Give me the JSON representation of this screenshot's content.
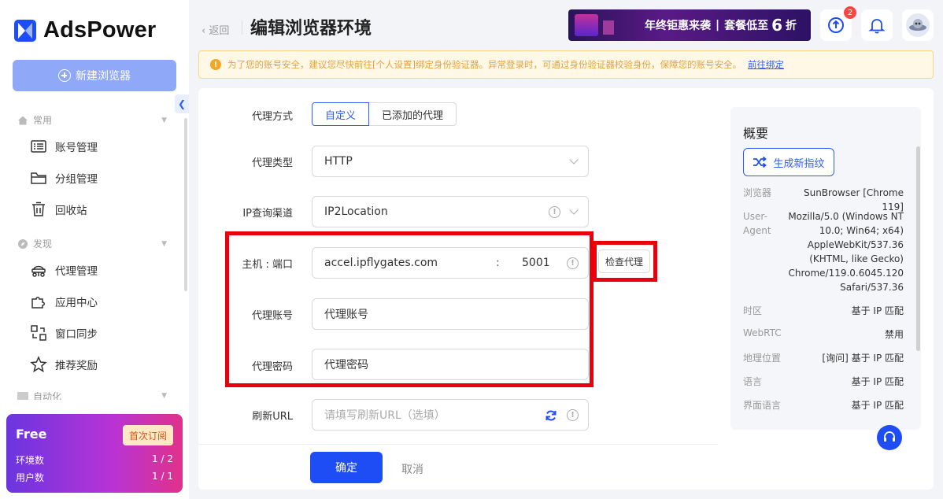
{
  "app": {
    "name": "AdsPower",
    "new_browser": "新建浏览器"
  },
  "sidebar": {
    "section_common": "常用",
    "section_discover": "发现",
    "section_auto": "自动化",
    "items": [
      {
        "label": "账号管理",
        "icon": "account-list-icon"
      },
      {
        "label": "分组管理",
        "icon": "folder-icon"
      },
      {
        "label": "回收站",
        "icon": "trash-icon"
      },
      {
        "label": "代理管理",
        "icon": "proxy-icon"
      },
      {
        "label": "应用中心",
        "icon": "puzzle-icon"
      },
      {
        "label": "窗口同步",
        "icon": "sync-icon"
      },
      {
        "label": "推荐奖励",
        "icon": "star-icon"
      }
    ]
  },
  "plan": {
    "name": "Free",
    "cta": "首次订阅",
    "env_label": "环境数",
    "env_value": "1 / 2",
    "user_label": "用户数",
    "user_value": "1 / 1"
  },
  "header": {
    "back": "返回",
    "title": "编辑浏览器环境",
    "notification_count": "2",
    "banner": {
      "text1": "年终钜惠来袭",
      "sep": "|",
      "text2": "套餐低至",
      "big": "6",
      "text3": "折"
    }
  },
  "warning": {
    "text": "为了您的账号安全，建议您尽快前往[个人设置]绑定身份验证器。异常登录时，可通过身份验证器校验身份，保障您的账号安全。",
    "link": "前往绑定"
  },
  "form": {
    "proxy_mode_label": "代理方式",
    "proxy_mode_options": [
      "自定义",
      "已添加的代理"
    ],
    "proxy_type_label": "代理类型",
    "proxy_type_value": "HTTP",
    "ip_channel_label": "IP查询渠道",
    "ip_channel_value": "IP2Location",
    "host_label": "主机 : 端口",
    "host_value": "accel.ipflygates.com",
    "colon": ":",
    "port_value": "5001",
    "check_proxy": "检查代理",
    "account_label": "代理账号",
    "account_value": "代理账号",
    "password_label": "代理密码",
    "password_value": "代理密码",
    "refresh_label": "刷新URL",
    "refresh_placeholder": "请填写刷新URL（选填）",
    "ok": "确定",
    "cancel": "取消"
  },
  "overview": {
    "title": "概要",
    "generate": "生成新指纹",
    "rows": [
      {
        "k": "浏览器",
        "v": "SunBrowser [Chrome 119]"
      },
      {
        "k": "User-Agent",
        "v": "Mozilla/5.0 (Windows NT 10.0; Win64; x64) AppleWebKit/537.36 (KHTML, like Gecko) Chrome/119.0.6045.120 Safari/537.36"
      },
      {
        "k": "时区",
        "v": "基于 IP 匹配"
      },
      {
        "k": "WebRTC",
        "v": "禁用"
      },
      {
        "k": "地理位置",
        "v": "[询问] 基于 IP 匹配"
      },
      {
        "k": "语言",
        "v": "基于 IP 匹配"
      },
      {
        "k": "界面语言",
        "v": "基于 IP 匹配"
      }
    ]
  },
  "colors": {
    "primary": "#1e4df5",
    "highlight": "#e8000b",
    "warning": "#f5a623"
  }
}
